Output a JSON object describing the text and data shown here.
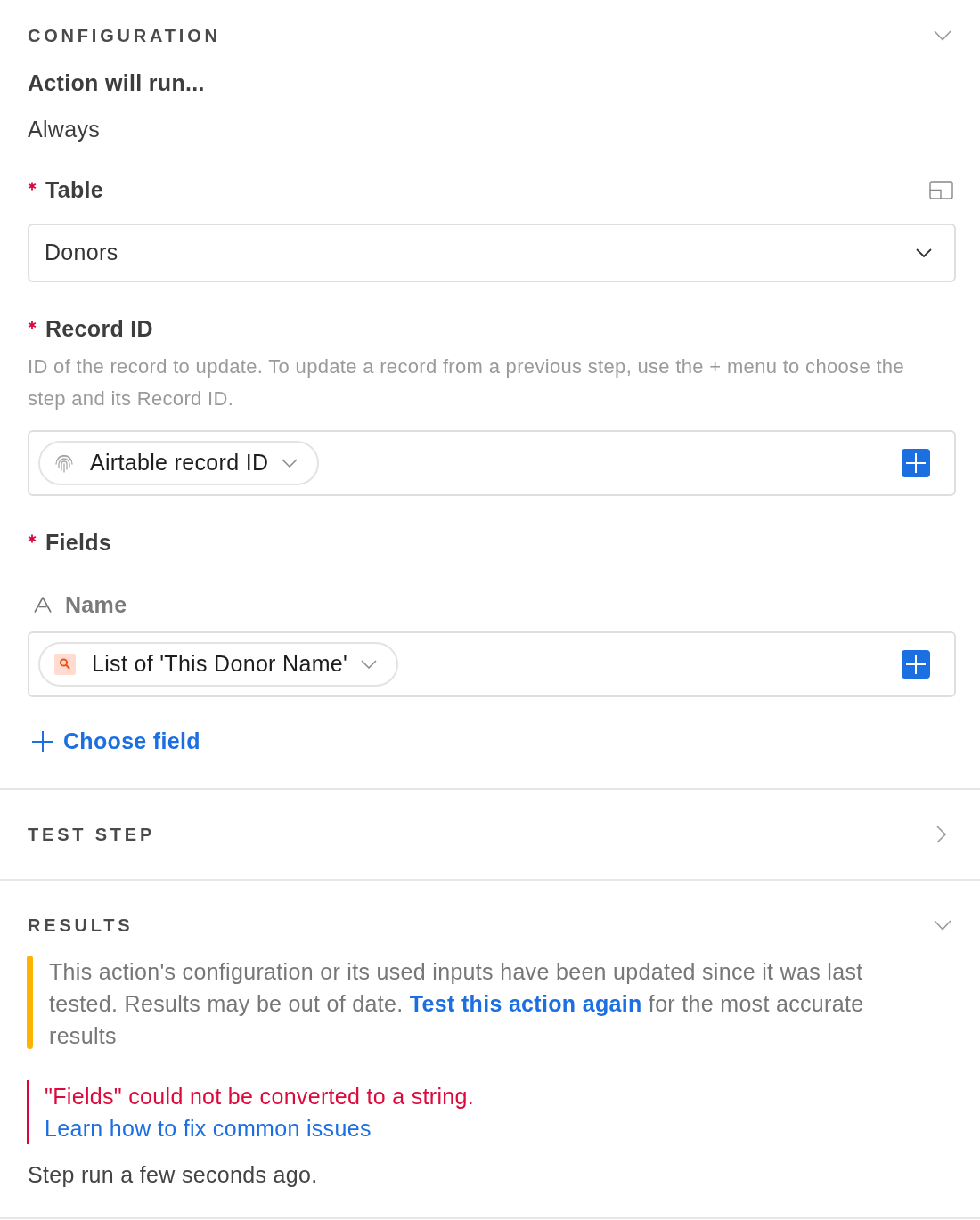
{
  "configuration": {
    "title": "CONFIGURATION",
    "expanded": true,
    "run_condition": {
      "label": "Action will run...",
      "value": "Always"
    },
    "table": {
      "label": "Table",
      "required": true,
      "value": "Donors"
    },
    "record_id": {
      "label": "Record ID",
      "required": true,
      "help": "ID of the record to update. To update a record from a previous step, use the + menu to choose the step and its Record ID.",
      "token": {
        "kind": "record-id",
        "label": "Airtable record ID"
      }
    },
    "fields": {
      "label": "Fields",
      "required": true,
      "items": [
        {
          "kind": "text",
          "name": "Name",
          "token": {
            "kind": "lookup",
            "label": "List of 'This Donor Name'"
          }
        }
      ],
      "add_label": "Choose field"
    }
  },
  "test_step": {
    "title": "TEST STEP",
    "expanded": false
  },
  "results": {
    "title": "RESULTS",
    "expanded": true,
    "warning": {
      "text_before": "This action's configuration or its used inputs have been updated since it was last tested. Results may be out of date.",
      "link": "Test this action again",
      "text_after": "for the most accurate results"
    },
    "error": {
      "message": "\"Fields\" could not be converted to a string.",
      "link": "Learn how to fix common issues"
    },
    "status": "Step run a few seconds ago."
  }
}
